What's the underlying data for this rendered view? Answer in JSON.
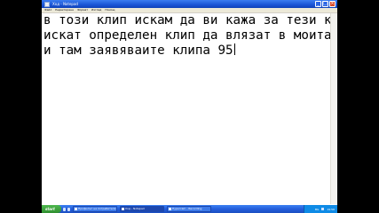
{
  "window": {
    "title": "Ход - Notepad",
    "controls": {
      "minimize": "_",
      "maximize": "□",
      "close": "×"
    }
  },
  "menu": {
    "items": [
      "Файл",
      "Редактиране",
      "Формат",
      "Изглед",
      "Помощ"
    ]
  },
  "editor": {
    "lines": [
      "в този клип искам да ви кажа за тези които",
      "искат определен клип да влязат в моита група",
      "и там заявяваите клипа 95"
    ]
  },
  "taskbar": {
    "start_label": "start",
    "tasks": [
      {
        "label": "Профилът на потребителя"
      },
      {
        "label": "Ход - Notepad"
      },
      {
        "label": "Hypercam - Recording"
      }
    ],
    "tray": {
      "language": "BG",
      "clock": "19:56"
    }
  },
  "colors": {
    "titlebar": "#1a55d6",
    "taskbar": "#245edb",
    "start": "#2f8f2f",
    "tray": "#0f8be6"
  }
}
